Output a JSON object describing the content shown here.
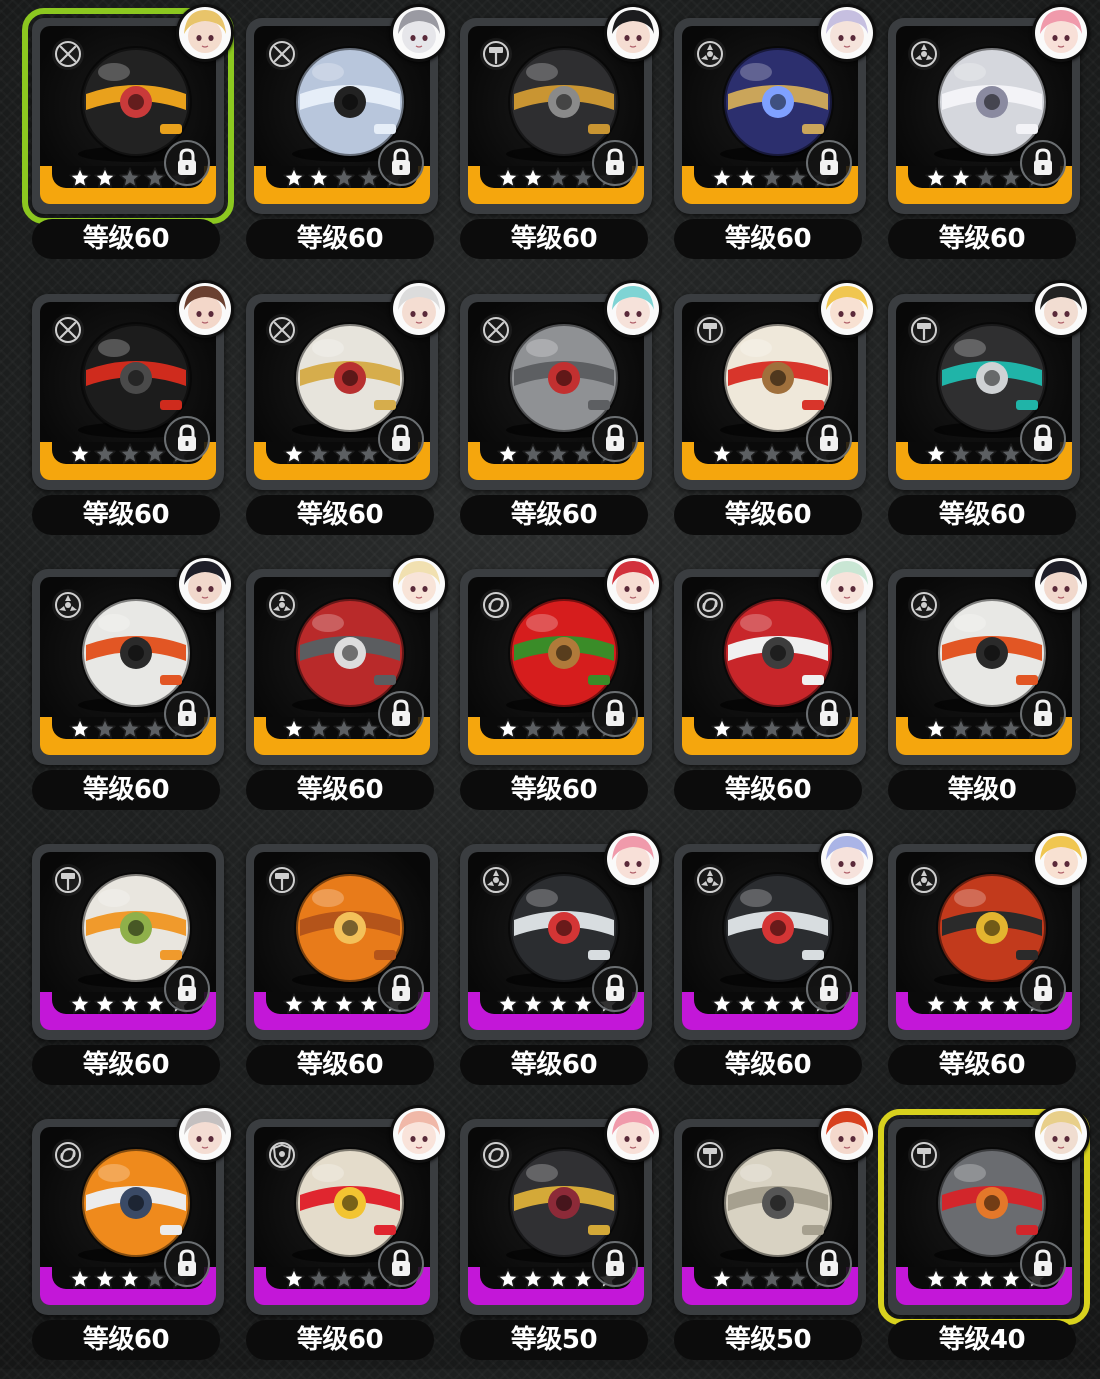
{
  "colors": {
    "band_orange": "#f5a60d",
    "band_purple": "#c317d8",
    "selected_green": "#8cc820",
    "selected_yellow": "#d8d21e",
    "star_gold": "#ffffff",
    "star_empty": "#5c5f62"
  },
  "grid": {
    "rows": [
      [
        {
          "art": "black-gold-cylinder-engine",
          "type_icon": "crossed-blades-icon",
          "avatar": "blonde-eyepatch-portrait",
          "stars": 2,
          "max_stars": 5,
          "band": "orange",
          "selected": "green",
          "level": "等级60"
        },
        {
          "art": "silver-crystal-shard-engine",
          "type_icon": "crossed-blades-icon",
          "avatar": "silver-hair-masked-portrait",
          "stars": 2,
          "max_stars": 5,
          "band": "orange",
          "selected": "",
          "level": "等级60"
        },
        {
          "art": "strapped-black-sphere-engine",
          "type_icon": "hammer-icon",
          "avatar": "black-hair-portrait",
          "stars": 2,
          "max_stars": 5,
          "band": "orange",
          "selected": "",
          "level": "等级60"
        },
        {
          "art": "gold-frame-blue-core-engine",
          "type_icon": "reactor-icon",
          "avatar": "lavender-hair-portrait",
          "stars": 2,
          "max_stars": 5,
          "band": "orange",
          "selected": "",
          "level": "等级60"
        },
        {
          "art": "white-bow-wrapped-engine",
          "type_icon": "reactor-icon",
          "avatar": "pink-hair-portrait",
          "stars": 2,
          "max_stars": 5,
          "band": "orange",
          "selected": "",
          "level": "等级60"
        }
      ],
      [
        {
          "art": "red-black-knuckle-engine",
          "type_icon": "crossed-blades-icon",
          "avatar": "brown-hair-portrait",
          "stars": 1,
          "max_stars": 5,
          "band": "orange",
          "selected": "",
          "level": "等级60"
        },
        {
          "art": "gold-stripe-white-sphere-engine",
          "type_icon": "crossed-blades-icon",
          "avatar": "white-hair-portrait",
          "stars": 1,
          "max_stars": 5,
          "band": "orange",
          "selected": "",
          "level": "等级60"
        },
        {
          "art": "grey-moon-sphere-engine",
          "type_icon": "crossed-blades-icon",
          "avatar": "teal-hair-portrait",
          "stars": 1,
          "max_stars": 5,
          "band": "orange",
          "selected": "",
          "level": "等级60"
        },
        {
          "art": "white-red-star-capsule-engine",
          "type_icon": "hammer-icon",
          "avatar": "blonde-hair-portrait",
          "stars": 1,
          "max_stars": 5,
          "band": "orange",
          "selected": "",
          "level": "等级60"
        },
        {
          "art": "teal-chain-disc-engine",
          "type_icon": "hammer-icon",
          "avatar": "black-white-hair-portrait",
          "stars": 1,
          "max_stars": 5,
          "band": "orange",
          "selected": "",
          "level": "等级60"
        }
      ],
      [
        {
          "art": "white-orange-striped-sphere-engine",
          "type_icon": "reactor-icon",
          "avatar": "dark-hair-horned-portrait",
          "stars": 1,
          "max_stars": 5,
          "band": "orange",
          "selected": "",
          "level": "等级60"
        },
        {
          "art": "red-holed-sphere-engine",
          "type_icon": "reactor-icon",
          "avatar": "cream-hair-portrait",
          "stars": 1,
          "max_stars": 5,
          "band": "orange",
          "selected": "",
          "level": "等级60"
        },
        {
          "art": "red-apple-engine",
          "type_icon": "swirl-icon",
          "avatar": "red-hair-portrait",
          "stars": 1,
          "max_stars": 5,
          "band": "orange",
          "selected": "",
          "level": "等级60"
        },
        {
          "art": "red-winged-dial-engine",
          "type_icon": "swirl-icon",
          "avatar": "mint-hair-portrait",
          "stars": 1,
          "max_stars": 5,
          "band": "orange",
          "selected": "",
          "level": "等级60"
        },
        {
          "art": "white-orange-striped-sphere-engine",
          "type_icon": "reactor-icon",
          "avatar": "dark-hair-horned-portrait",
          "stars": 1,
          "max_stars": 5,
          "band": "orange",
          "selected": "",
          "level": "等级0"
        }
      ],
      [
        {
          "art": "shrimp-rice-bowl-engine",
          "type_icon": "hammer-icon",
          "avatar": "",
          "stars": 5,
          "max_stars": 5,
          "band": "purple",
          "selected": "",
          "level": "等级60"
        },
        {
          "art": "orange-pizza-engine",
          "type_icon": "hammer-icon",
          "avatar": "",
          "stars": 5,
          "max_stars": 5,
          "band": "purple",
          "selected": "",
          "level": "等级60"
        },
        {
          "art": "goggle-black-helmet-engine",
          "type_icon": "reactor-icon",
          "avatar": "pink-hair-portrait",
          "stars": 5,
          "max_stars": 5,
          "band": "purple",
          "selected": "",
          "level": "等级60"
        },
        {
          "art": "goggle-black-helmet-engine",
          "type_icon": "reactor-icon",
          "avatar": "blue-white-hair-portrait",
          "stars": 5,
          "max_stars": 5,
          "band": "purple",
          "selected": "",
          "level": "等级60"
        },
        {
          "art": "red-drum-stack-engine",
          "type_icon": "reactor-icon",
          "avatar": "blonde-hair-portrait",
          "stars": 5,
          "max_stars": 5,
          "band": "purple",
          "selected": "",
          "level": "等级60"
        }
      ],
      [
        {
          "art": "orange-camera-engine",
          "type_icon": "swirl-icon",
          "avatar": "grey-hair-portrait",
          "stars": 3,
          "max_stars": 5,
          "band": "purple",
          "selected": "",
          "level": "等级60"
        },
        {
          "art": "star-badge-sphere-engine",
          "type_icon": "shield-icon",
          "avatar": "peach-hair-portrait",
          "stars": 1,
          "max_stars": 5,
          "band": "purple",
          "selected": "",
          "level": "等级60"
        },
        {
          "art": "gold-valve-gear-engine",
          "type_icon": "swirl-icon",
          "avatar": "pink-hair-portrait",
          "stars": 5,
          "max_stars": 5,
          "band": "purple",
          "selected": "",
          "level": "等级50"
        },
        {
          "art": "beige-capsule-engine",
          "type_icon": "hammer-icon",
          "avatar": "red-hair-glasses-portrait",
          "stars": 1,
          "max_stars": 5,
          "band": "purple",
          "selected": "",
          "level": "等级50"
        },
        {
          "art": "grey-red-helmet-engine",
          "type_icon": "hammer-icon",
          "avatar": "blonde-masked-portrait",
          "stars": 5,
          "max_stars": 5,
          "band": "purple",
          "selected": "yellow",
          "level": "等级40"
        }
      ]
    ]
  }
}
